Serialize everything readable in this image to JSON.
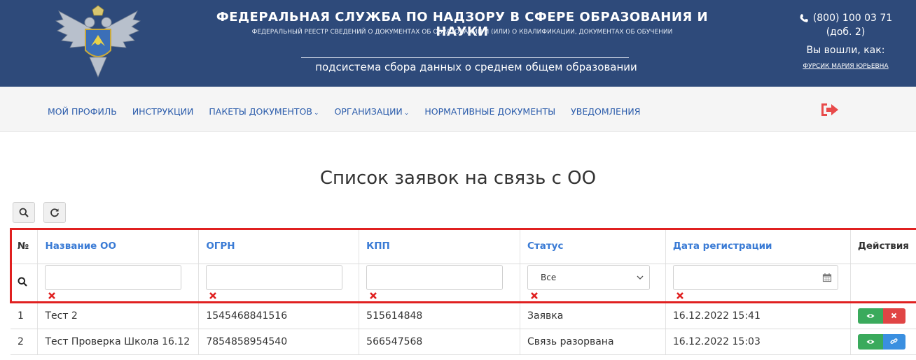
{
  "header": {
    "title": "ФЕДЕРАЛЬНАЯ СЛУЖБА ПО НАДЗОРУ В СФЕРЕ ОБРАЗОВАНИЯ И НАУКИ",
    "subtitle": "ФЕДЕРАЛЬНЫЙ РЕЕСТР СВЕДЕНИЙ О ДОКУМЕНТАХ ОБ ОБРАЗОВАНИИ И (ИЛИ) О КВАЛИФИКАЦИИ, ДОКУМЕНТАХ ОБ ОБУЧЕНИИ",
    "subsystem": "подсистема сбора данных о среднем общем образовании",
    "phone": "(800) 100 03 71",
    "ext": "(доб. 2)",
    "logged_in_as": "Вы вошли, как:",
    "user_name": "ФУРСИК МАРИЯ ЮРЬЕВНА",
    "brand_color": "#2e4a7a"
  },
  "nav": {
    "items": [
      {
        "label": "МОЙ ПРОФИЛЬ"
      },
      {
        "label": "ИНСТРУКЦИИ"
      },
      {
        "label": "ПАКЕТЫ ДОКУМЕНТОВ",
        "dropdown": true
      },
      {
        "label": "ОРГАНИЗАЦИИ",
        "dropdown": true
      },
      {
        "label": "НОРМАТИВНЫЕ ДОКУМЕНТЫ"
      },
      {
        "label": "УВЕДОМЛЕНИЯ"
      }
    ],
    "chevron": "⌄",
    "logout_icon": "logout-icon",
    "logout_color": "#e84a4a"
  },
  "page": {
    "title": "Список заявок на связь с ОО"
  },
  "toolbar": {
    "search_icon": "search-icon",
    "refresh_icon": "refresh-icon"
  },
  "table": {
    "columns": {
      "num": "№",
      "name": "Название ОО",
      "ogrn": "ОГРН",
      "kpp": "КПП",
      "status": "Статус",
      "date": "Дата регистрации",
      "actions": "Действия"
    },
    "filters": {
      "name": "",
      "ogrn": "",
      "kpp": "",
      "status_selected": "Все",
      "date": ""
    },
    "rows": [
      {
        "num": "1",
        "name": "Тест 2",
        "ogrn": "1545468841516",
        "kpp": "515614848",
        "status": "Заявка",
        "date": "16.12.2022 15:41",
        "actions": [
          "view",
          "delete"
        ]
      },
      {
        "num": "2",
        "name": "Тест Проверка Школа 16.12",
        "ogrn": "7854858954540",
        "kpp": "566547568",
        "status": "Связь разорвана",
        "date": "16.12.2022 15:03",
        "actions": [
          "view",
          "link"
        ]
      }
    ],
    "header_link_color": "#3a7bd5",
    "highlight_color": "#e02020"
  }
}
